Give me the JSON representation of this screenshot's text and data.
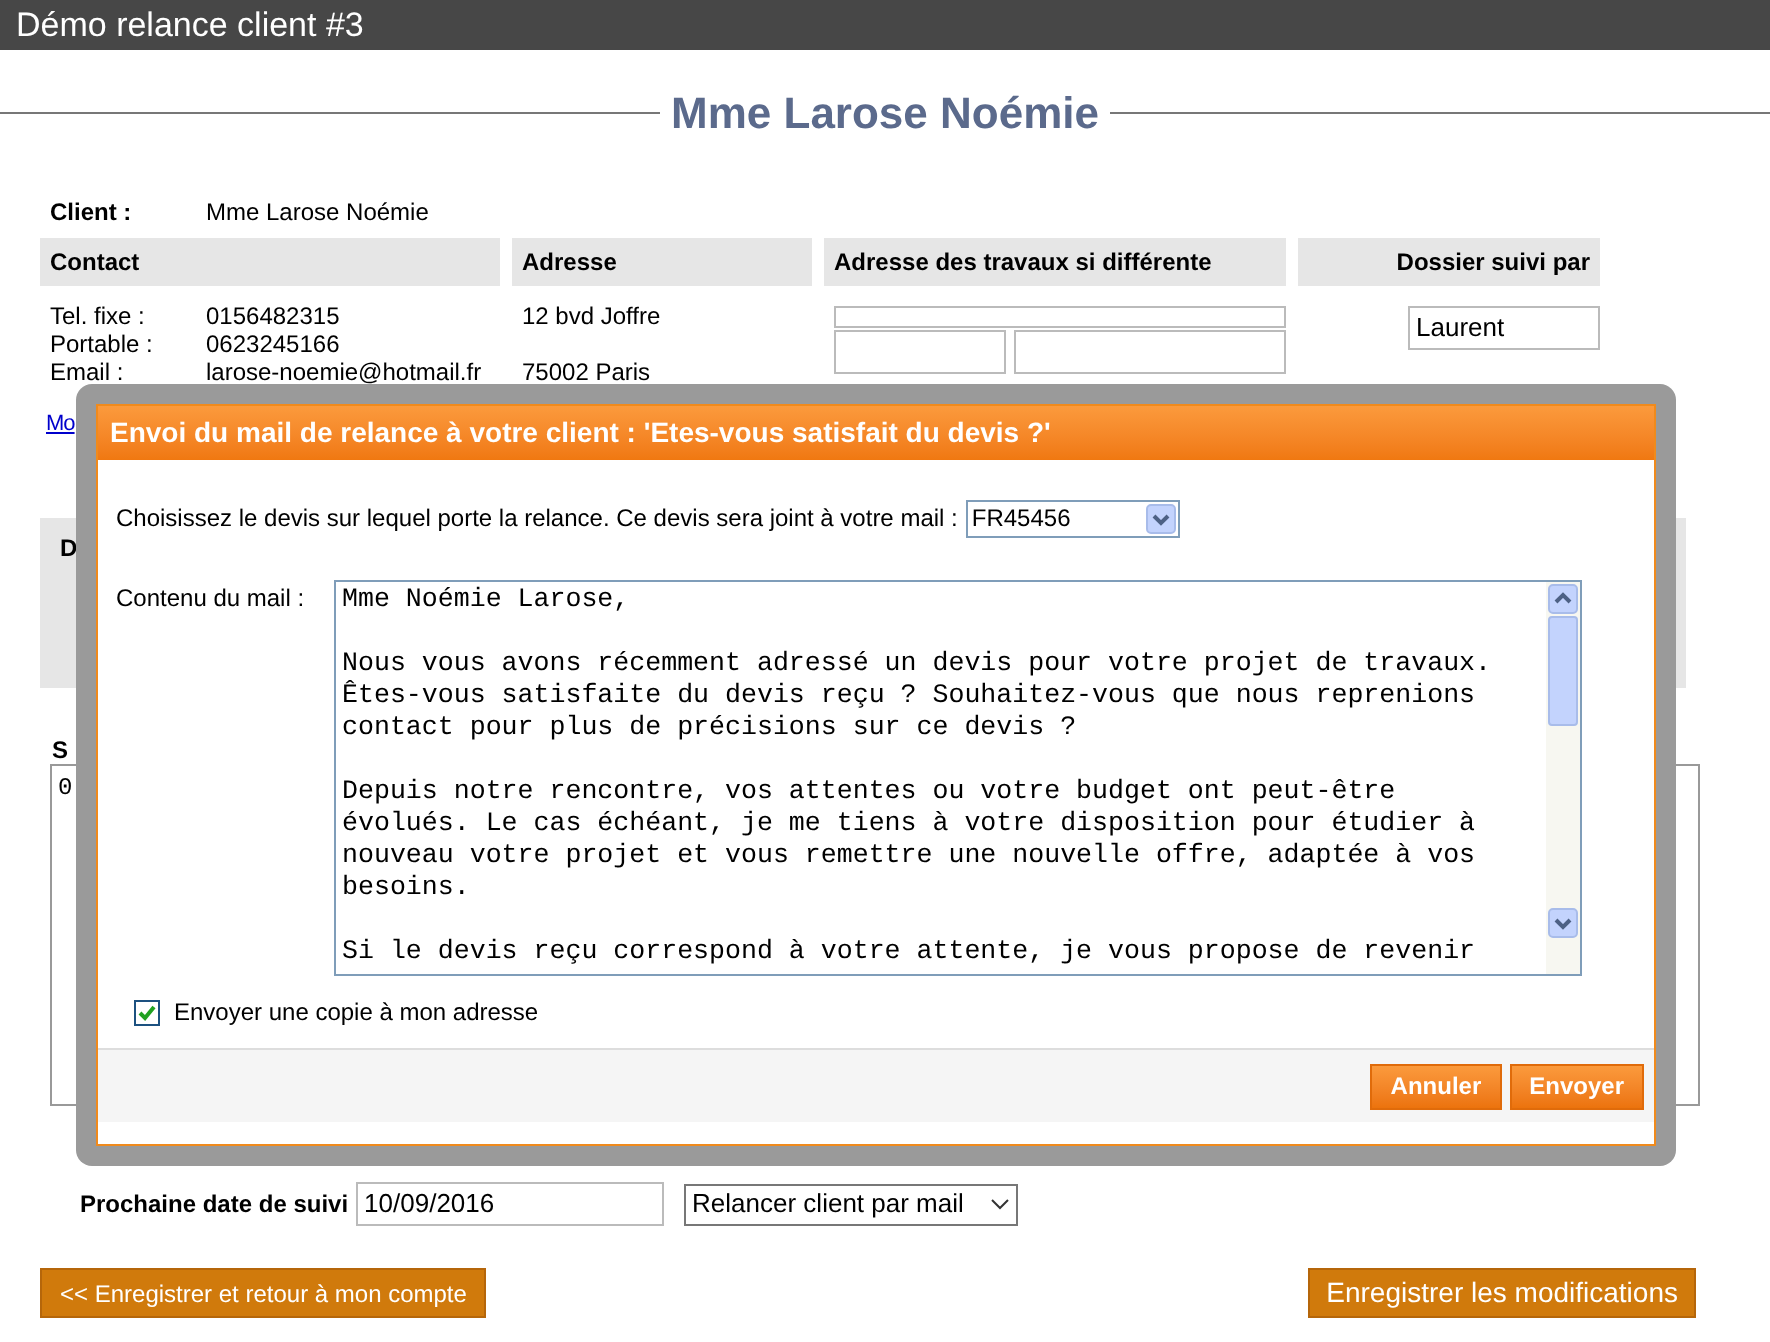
{
  "window": {
    "title": "Démo relance client #3"
  },
  "heading": "Mme Larose Noémie",
  "client": {
    "label": "Client :",
    "value": "Mme Larose Noémie"
  },
  "columns": [
    "Contact",
    "Adresse",
    "Adresse des travaux si différente",
    "Dossier suivi par"
  ],
  "contact": [
    {
      "label": "Tel. fixe :",
      "value": "0156482315"
    },
    {
      "label": "Portable :",
      "value": "0623245166"
    },
    {
      "label": "Email :",
      "value": "larose-noemie@hotmail.fr"
    }
  ],
  "address": [
    "12 bvd Joffre",
    "75002 Paris"
  ],
  "followed_by": {
    "value": "Laurent"
  },
  "link": "Mo",
  "section_label": "D",
  "notes": {
    "label": "S",
    "value": "0"
  },
  "next_followup": {
    "label": "Prochaine date de suivi",
    "value": "10/09/2016",
    "action": "Relancer client par mail"
  },
  "buttons": [
    {
      "label": "<< Enregistrer et retour à mon compte"
    },
    {
      "label": "Enregistrer les modifications"
    }
  ],
  "dialog": {
    "title": "Envoi du mail de relance à votre client : 'Etes-vous satisfait du devis ?'",
    "quote_prompt": "Choisissez le devis sur lequel porte la relance. Ce devis sera joint à votre mail :",
    "quote": "FR45456",
    "body_label": "Contenu du mail :",
    "body": "Mme Noémie Larose,\n\nNous vous avons récemment adressé un devis pour votre projet de travaux.\nÊtes-vous satisfaite du devis reçu ? Souhaitez-vous que nous reprenions\ncontact pour plus de précisions sur ce devis ?\n\nDepuis notre rencontre, vos attentes ou votre budget ont peut-être\névolués. Le cas échéant, je me tiens à votre disposition pour étudier à\nnouveau votre projet et vous remettre une nouvelle offre, adaptée à vos\nbesoins.\n\nSi le devis reçu correspond à votre attente, je vous propose de revenir",
    "copy": {
      "label": "Envoyer une copie à mon adresse",
      "checked": true
    },
    "buttons": [
      "Annuler",
      "Envoyer"
    ]
  }
}
